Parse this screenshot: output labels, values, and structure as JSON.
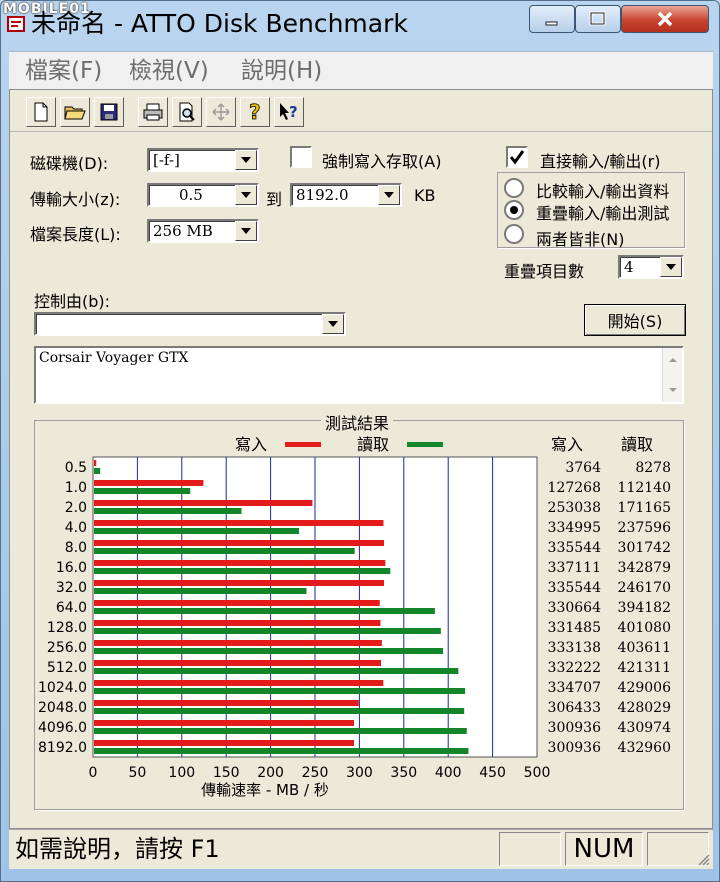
{
  "window": {
    "title": "未命名 - ATTO Disk Benchmark",
    "watermark": "MOBILE01"
  },
  "menu": [
    "檔案(F)",
    "檢視(V)",
    "說明(H)"
  ],
  "toolbar_icons": [
    "new-file",
    "open-folder",
    "save",
    "print",
    "print-preview",
    "move",
    "help",
    "context-help"
  ],
  "form": {
    "drive_label": "磁碟機(D):",
    "drive_value": "[-f-]",
    "transfer_label": "傳輸大小(z):",
    "transfer_from": "0.5",
    "to_label": "到",
    "transfer_to": "8192.0",
    "unit": "KB",
    "length_label": "檔案長度(L):",
    "length_value": "256 MB",
    "force_write_label": "強制寫入存取(A)",
    "direct_io_label": "直接輸入/輸出(r)",
    "radio_compare": "比較輸入/輸出資料",
    "radio_overlap": "重疊輸入/輸出測試",
    "radio_neither": "兩者皆非(N)",
    "queue_label": "重疊項目數",
    "queue_value": "4",
    "controlled_label": "控制由(b):",
    "controlled_value": "",
    "start_button": "開始(S)",
    "description": "Corsair Voyager GTX"
  },
  "chart_data": {
    "type": "bar",
    "title": "測試結果",
    "legend": [
      "寫入",
      "讀取"
    ],
    "column_headers": [
      "寫入",
      "讀取"
    ],
    "xlabel": "傳輸速率 - MB / 秒",
    "xlim": [
      0,
      500
    ],
    "xticks": [
      "0",
      "50",
      "100",
      "150",
      "200",
      "250",
      "300",
      "350",
      "400",
      "450",
      "500"
    ],
    "categories": [
      "0.5",
      "1.0",
      "2.0",
      "4.0",
      "8.0",
      "16.0",
      "32.0",
      "64.0",
      "128.0",
      "256.0",
      "512.0",
      "1024.0",
      "2048.0",
      "4096.0",
      "8192.0"
    ],
    "series": [
      {
        "name": "寫入",
        "color": "#e41b1b",
        "values": [
          3.7,
          124.3,
          247.1,
          327.1,
          327.7,
          329.2,
          327.7,
          322.9,
          323.7,
          325.3,
          324.4,
          326.9,
          299.3,
          293.9,
          293.9
        ],
        "labels": [
          "3764",
          "127268",
          "253038",
          "334995",
          "335544",
          "337111",
          "335544",
          "330664",
          "331485",
          "333138",
          "332222",
          "334707",
          "306433",
          "300936",
          "300936"
        ]
      },
      {
        "name": "讀取",
        "color": "#13862a",
        "values": [
          8.1,
          109.5,
          167.2,
          232.0,
          294.7,
          334.8,
          240.4,
          385.0,
          391.7,
          394.2,
          411.4,
          419.0,
          418.0,
          420.9,
          422.8
        ],
        "labels": [
          "8278",
          "112140",
          "171165",
          "237596",
          "301742",
          "342879",
          "246170",
          "394182",
          "401080",
          "403611",
          "421311",
          "429006",
          "428029",
          "430974",
          "432960"
        ]
      }
    ]
  },
  "status": {
    "help_text": "如需說明，請按 F1",
    "num": "NUM"
  }
}
